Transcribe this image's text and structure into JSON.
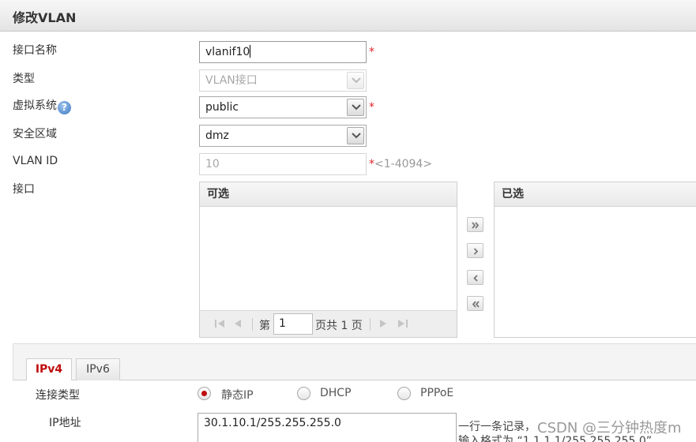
{
  "dialog": {
    "title": "修改VLAN"
  },
  "form": {
    "name_label": "接口名称",
    "name_value": "vlanif10",
    "type_label": "类型",
    "type_value": "VLAN接口",
    "vsys_label": "虚拟系统",
    "vsys_value": "public",
    "zone_label": "安全区域",
    "zone_value": "dmz",
    "vlanid_label": "VLAN ID",
    "vlanid_value": "10",
    "vlanid_range": "<1-4094>",
    "required_mark": "*",
    "help_glyph": "?"
  },
  "interfaces": {
    "label": "接口",
    "available_header": "可选",
    "selected_header": "已选",
    "pager": {
      "prefix": "第",
      "page": "1",
      "suffix": "页共 1 页"
    }
  },
  "ip_section": {
    "tabs": [
      {
        "label": "IPv4",
        "active": true
      },
      {
        "label": "IPv6",
        "active": false
      }
    ],
    "conn_type_label": "连接类型",
    "conn_options": [
      {
        "label": "静态IP",
        "selected": true
      },
      {
        "label": "DHCP",
        "selected": false
      },
      {
        "label": "PPPoE",
        "selected": false
      }
    ],
    "ip_label": "IP地址",
    "ip_value": "30.1.10.1/255.255.255.0",
    "note_line1": "一行一条记录，",
    "note_line2": "输入格式为 “1.1.1.1/255.255.255.0”"
  },
  "watermark": "CSDN @三分钟热度m",
  "colors": {
    "accent_red": "#c00d0d",
    "required_red": "#e0242b",
    "help_blue": "#3c78c0"
  },
  "icons": {
    "dropdown": "chevron-down-icon",
    "help": "question-circle-icon",
    "move_all_right": "double-chevron-right-icon",
    "move_right": "chevron-right-icon",
    "move_left": "chevron-left-icon",
    "move_all_left": "double-chevron-left-icon"
  }
}
